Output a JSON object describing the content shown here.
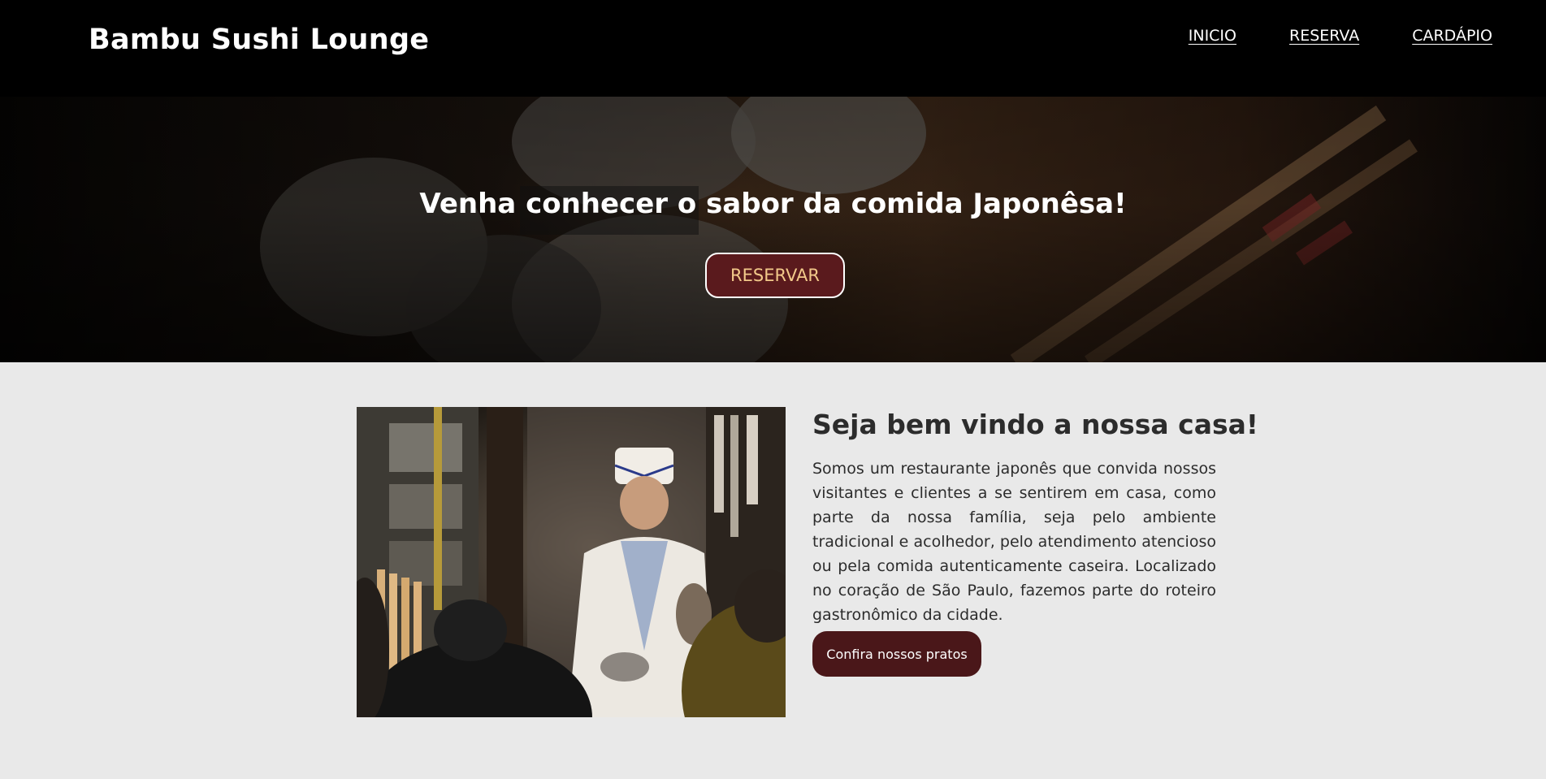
{
  "header": {
    "brand": "Bambu Sushi Lounge",
    "nav": [
      {
        "label": "INICIO"
      },
      {
        "label": "RESERVA"
      },
      {
        "label": "CARDÁPIO"
      }
    ]
  },
  "hero": {
    "title": "Venha conhecer o sabor da comida Japonêsa!",
    "button_label": "RESERVAR"
  },
  "welcome": {
    "title": "Seja bem vindo a nossa casa!",
    "body": "Somos um restaurante japonês que convida nossos visitantes e clientes a se sentirem em casa, como parte da nossa família, seja pelo ambiente tradicional e acolhedor, pelo atendimento atencioso ou pela comida autenticamente caseira. Localizado no coração de São Paulo, fazemos parte do roteiro gastronômico da cidade.",
    "button_label": "Confira nossos pratos"
  },
  "colors": {
    "header_bg": "#000000",
    "accent": "#5a1a1d",
    "page_bg": "#e9e9e9"
  }
}
